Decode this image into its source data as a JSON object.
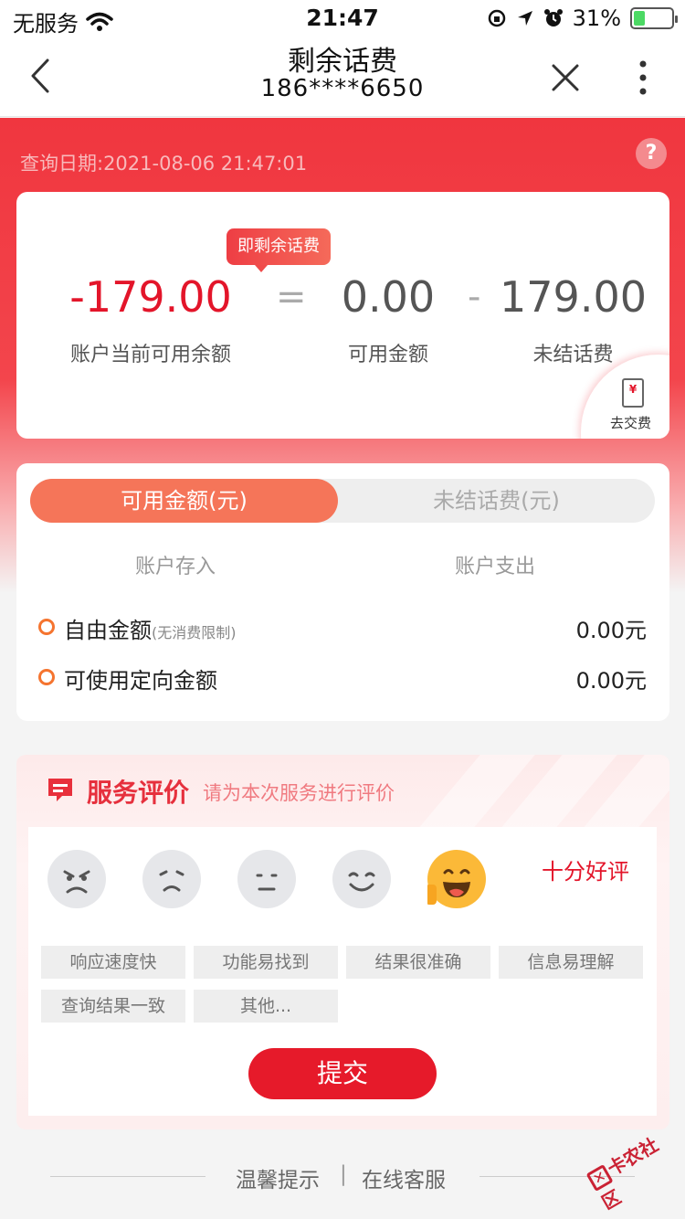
{
  "status_bar": {
    "carrier": "无服务",
    "time": "21:47",
    "battery": "31%",
    "battery_level": 0.31
  },
  "nav": {
    "title": "剩余话费",
    "subtitle": "186****6650"
  },
  "header": {
    "query_date": "查询日期:2021-08-06 21:47:01",
    "help_glyph": "?"
  },
  "balance": {
    "tooltip": "即剩余话费",
    "current_value": "-179.00",
    "current_label": "账户当前可用余额",
    "equals": "=",
    "available_value": "0.00",
    "available_label": "可用金额",
    "minus": "-",
    "unsettled_value": "179.00",
    "unsettled_label": "未结话费",
    "pay_label": "去交费",
    "pay_icon_glyph": "¥"
  },
  "detail": {
    "tabs": [
      "可用金额(元)",
      "未结话费(元)"
    ],
    "active_tab": 0,
    "col_in": "账户存入",
    "col_out": "账户支出",
    "rows": [
      {
        "label": "自由金额",
        "note": "(无消费限制)",
        "value": "0.00元"
      },
      {
        "label": "可使用定向金额",
        "note": "",
        "value": "0.00元"
      }
    ]
  },
  "rating": {
    "title": "服务评价",
    "subtitle": "请为本次服务进行评价",
    "verdict": "十分好评",
    "selected_face": 5,
    "tags": [
      "响应速度快",
      "功能易找到",
      "结果很准确",
      "信息易理解",
      "查询结果一致",
      "其他..."
    ],
    "submit": "提交"
  },
  "footer": {
    "tips": "温馨提示",
    "separator": "|",
    "customer_service": "在线客服"
  },
  "watermark": {
    "text": "卡农社区"
  },
  "colors": {
    "brand_red": "#e61a2a",
    "accent_orange": "#f57559"
  }
}
